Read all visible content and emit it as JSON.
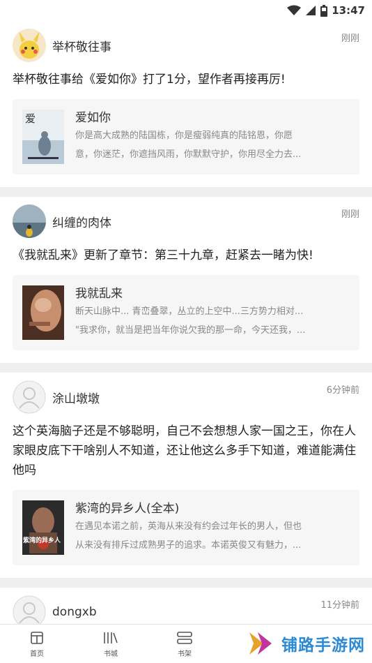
{
  "status_bar": {
    "time": "13:47"
  },
  "posts": [
    {
      "username": "举杯敬往事",
      "time": "刚刚",
      "text": "举杯敬往事给《爱如你》打了1分，望作者再接再厉!",
      "book": {
        "title": "爱如你",
        "desc1": "你是高大成熟的陆国栋，你是瘦弱纯真的陆铭恩，你愿",
        "desc2": "意，你迷茫，你遮挡风雨，你默默守护，你用尽全力去...",
        "cover_text": "爱"
      }
    },
    {
      "username": "纠缠的肉体",
      "time": "刚刚",
      "text": "《我就乱来》更新了章节：第三十九章，赶紧去一睹为快!",
      "book": {
        "title": "我就乱来",
        "desc1": "断天山脉中... 青峦叠翠，丛立的上空中...三方势力相对...",
        "desc2": "\"我求你，就当是把当年你说欠我的那一命，今天还我，..."
      }
    },
    {
      "username": "涂山墩墩",
      "time": "6分钟前",
      "text": "这个英海脑子还是不够聪明，自己不会想想人家一国之王，你在人家眼皮底下干啥别人不知道，还让他这么多手下知道，难道能满住他吗",
      "book": {
        "title": "紫湾的异乡人(全本)",
        "desc1": "在遇见本诺之前，英海从来没有约会过年长的男人，但也",
        "desc2": "从来没有排斥过成熟男子的追求。本诺英俊又有魅力，...",
        "cover_text": "紫湾的异乡人"
      }
    },
    {
      "username": "dongxb",
      "time": "11分钟前"
    }
  ],
  "tabs": [
    {
      "label": "首页",
      "icon": "home-icon"
    },
    {
      "label": "书城",
      "icon": "bookstore-icon"
    },
    {
      "label": "书架",
      "icon": "bookshelf-icon"
    }
  ],
  "watermark": {
    "text": "铺路手游网"
  }
}
